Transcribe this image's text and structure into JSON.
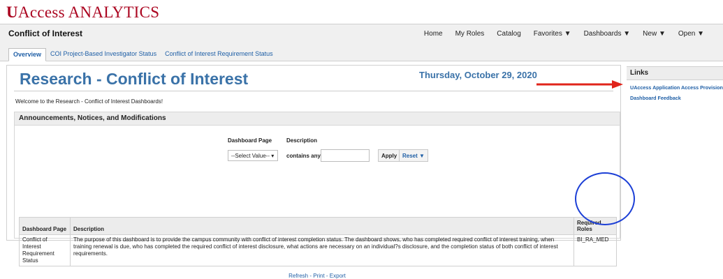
{
  "brand": {
    "u": "U",
    "rest": "Access ANALYTICS"
  },
  "header": {
    "app_title": "Conflict of Interest",
    "nav": [
      "Home",
      "My Roles",
      "Catalog",
      "Favorites ▼",
      "Dashboards ▼",
      "New ▼",
      "Open ▼"
    ],
    "tabs": [
      "Overview",
      "COI Project-Based Investigator Status",
      "Conflict of Interest Requirement Status"
    ]
  },
  "main": {
    "title": "Research - Conflict of Interest",
    "date": "Thursday, October 29, 2020",
    "welcome": "Welcome to the Research - Conflict of Interest Dashboards!",
    "section_title": "Announcements, Notices, and Modifications",
    "filters": {
      "page_label": "Dashboard Page",
      "desc_label": "Description",
      "select_value": "--Select Value--",
      "contains_label": "contains any",
      "apply_label": "Apply",
      "reset_label": "Reset ▼"
    },
    "table": {
      "headers": [
        "Dashboard Page",
        "Description",
        "Required Roles"
      ],
      "rows": [
        {
          "page": "Conflict of Interest Requirement Status",
          "description": "The purpose of this dashboard is to provide the campus community with conflict of interest completion status. The dashboard shows, who has completed required conflict of interest training, when training renewal is due, who has completed the required conflict of interest disclosure, what actions are necessary on an individual?s disclosure, and the completion status of both conflict of interest requirements.",
          "roles": "BI_RA_MED"
        }
      ]
    },
    "footer_links": {
      "refresh": "Refresh",
      "print": "Print",
      "export": "Export",
      "sep": " - "
    }
  },
  "sidebar": {
    "title": "Links",
    "links": [
      "UAccess Application Access Provisioning",
      "Dashboard Feedback"
    ]
  },
  "colors": {
    "brand": "#ab0520",
    "link": "#1f5fa6",
    "title": "#3a72a8",
    "annotation_arrow": "#e0241b",
    "annotation_circle": "#1c3fd6"
  }
}
